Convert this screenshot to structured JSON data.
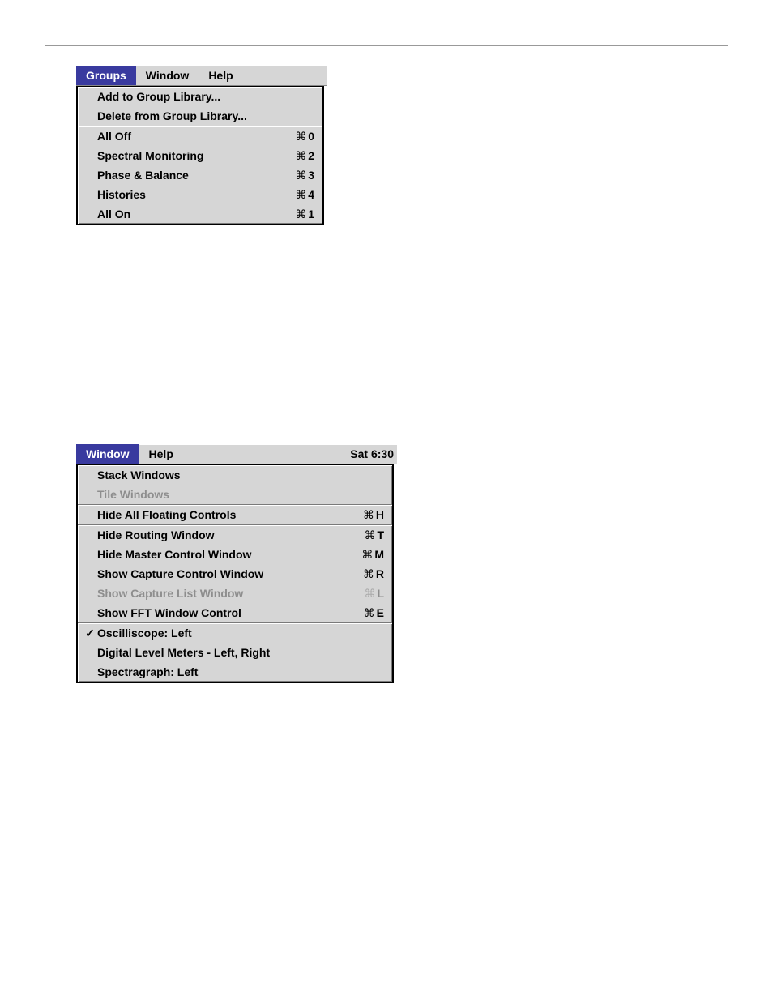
{
  "panel_groups": {
    "menubar": {
      "selected": "Groups",
      "items": [
        "Groups",
        "Window",
        "Help"
      ]
    },
    "sections": [
      {
        "items": [
          {
            "label": "Add to Group Library...",
            "shortcut": "",
            "disabled": false
          },
          {
            "label": "Delete from Group Library...",
            "shortcut": "",
            "disabled": false
          }
        ]
      },
      {
        "items": [
          {
            "label": "All Off",
            "shortcut": "0",
            "disabled": false
          },
          {
            "label": "Spectral Monitoring",
            "shortcut": "2",
            "disabled": false
          },
          {
            "label": "Phase & Balance",
            "shortcut": "3",
            "disabled": false
          },
          {
            "label": "Histories",
            "shortcut": "4",
            "disabled": false
          },
          {
            "label": "All On",
            "shortcut": "1",
            "disabled": false
          }
        ]
      }
    ]
  },
  "panel_window": {
    "menubar": {
      "selected": "Window",
      "items": [
        "Window",
        "Help"
      ],
      "clock": "Sat 6:30"
    },
    "sections": [
      {
        "items": [
          {
            "label": "Stack Windows",
            "shortcut": "",
            "disabled": false
          },
          {
            "label": "Tile Windows",
            "shortcut": "",
            "disabled": true
          }
        ]
      },
      {
        "items": [
          {
            "label": "Hide All Floating Controls",
            "shortcut": "H",
            "disabled": false
          }
        ]
      },
      {
        "items": [
          {
            "label": "Hide Routing Window",
            "shortcut": "T",
            "disabled": false
          },
          {
            "label": "Hide Master Control Window",
            "shortcut": "M",
            "disabled": false
          },
          {
            "label": "Show Capture Control Window",
            "shortcut": "R",
            "disabled": false
          },
          {
            "label": "Show Capture List Window",
            "shortcut": "L",
            "disabled": true
          },
          {
            "label": "Show FFT Window Control",
            "shortcut": "E",
            "disabled": false
          }
        ]
      },
      {
        "items": [
          {
            "label": "Oscilliscope: Left",
            "shortcut": "",
            "disabled": false,
            "checked": true
          },
          {
            "label": "Digital Level Meters - Left, Right",
            "shortcut": "",
            "disabled": false
          },
          {
            "label": "Spectragraph: Left",
            "shortcut": "",
            "disabled": false
          }
        ]
      }
    ]
  },
  "glyphs": {
    "cmd": "⌘",
    "check": "✓"
  }
}
